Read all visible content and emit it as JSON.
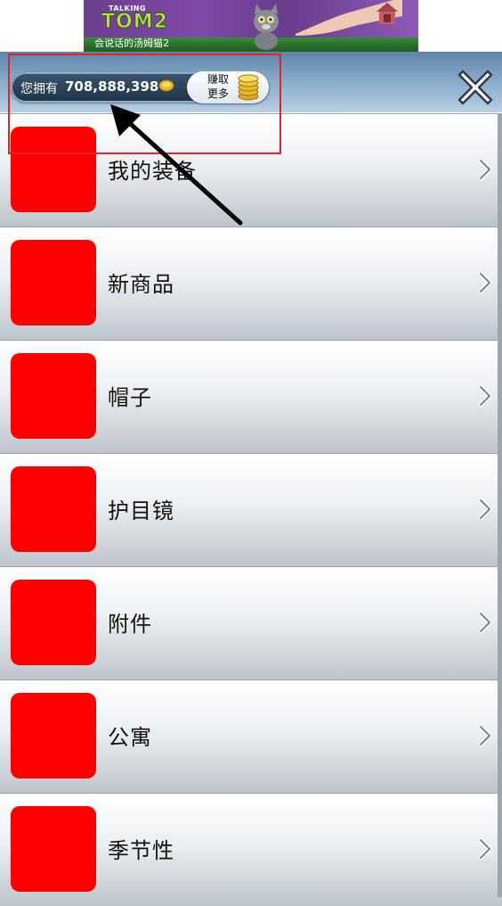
{
  "ad": {
    "logo_small": "TALKING",
    "logo_big": "TOM2",
    "caption": "会说话的汤姆猫2"
  },
  "header": {
    "coins_label": "您拥有",
    "coins_amount": "708,888,398",
    "earn_more_label": "赚取\n更多"
  },
  "menu": {
    "items": [
      {
        "label": "我的装备"
      },
      {
        "label": "新商品"
      },
      {
        "label": "帽子"
      },
      {
        "label": "护目镜"
      },
      {
        "label": "附件"
      },
      {
        "label": "公寓"
      },
      {
        "label": "季节性"
      }
    ]
  },
  "icons": {
    "close": "close-icon",
    "coin": "coin-icon",
    "coin_stack": "coin-stack-icon",
    "chevron": "chevron-right-icon"
  },
  "colors": {
    "highlight": "#e32424",
    "thumb_placeholder": "#ff0000",
    "topbar": "#7fa2c3"
  }
}
